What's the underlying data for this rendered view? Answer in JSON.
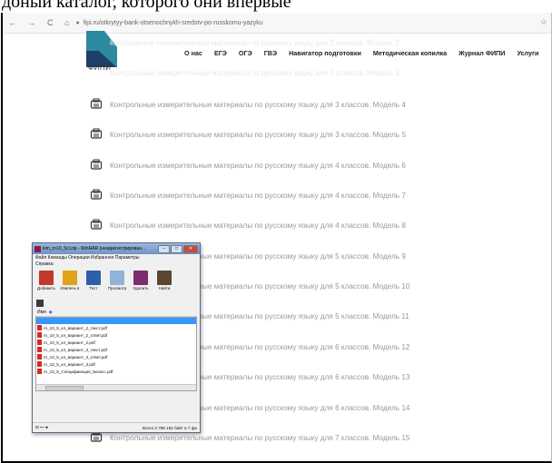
{
  "document_strip": "доный каталог, которого они впервые",
  "browser": {
    "nav_symbols": "← → C ⌂",
    "url": "fipi.ru/otkrytyy-bank-otsenochnykh-sredstv-po-russkomu-yazyku",
    "star": "☆"
  },
  "site": {
    "logo_text": "ФИПИ",
    "menu": [
      "О нас",
      "ЕГЭ",
      "ОГЭ",
      "ГВЭ",
      "Навигатор подготовки",
      "Методическая копилка",
      "Журнал ФИПИ",
      "Услуги"
    ],
    "ghost_lines": [
      "Контрольные измерительные материалы по русскому языку для 2 классов. Модель 2",
      "Контрольные измерительные материалы по русскому языку для 3 классов. Модель 3"
    ],
    "items": [
      "Контрольные измерительные материалы по русскому языку для 3 классов. Модель 4",
      "Контрольные измерительные материалы по русскому языку для 3 классов. Модель 5",
      "Контрольные измерительные материалы по русскому языку для 4 классов. Модель 6",
      "Контрольные измерительные материалы по русскому языку для 4 классов. Модель 7",
      "Контрольные измерительные материалы по русскому языку для 4 классов. Модель 8",
      "Контрольные измерительные материалы по русскому языку для 5 классов. Модель 9",
      "Контрольные измерительные материалы по русскому языку для 5 классов. Модель 10",
      "Контрольные измерительные материалы по русскому языку для 5 классов. Модель 11",
      "Контрольные измерительные материалы по русскому языку для 6 классов. Модель 12",
      "Контрольные измерительные материалы по русскому языку для 6 классов. Модель 13",
      "Контрольные измерительные материалы по русскому языку для 6 классов. Модель 14",
      "Контрольные измерительные материалы по русскому языку для 7 классов. Модель 15"
    ],
    "item_short": [
      "",
      "",
      "",
      "",
      "Контрольные изм",
      "ериалы по русскому языку для 5 классов. Модель 9",
      "ериалы по русскому языку для 5 классов. Модель 10",
      "ериалы по русскому языку для 5 классов. Модель 11",
      "ериалы по русскому языку для 6 классов. Модель 12",
      "ериалы по русскому языку для 6 классов. Модель 13",
      "ериалы по русскому языку для 6 классов. Модель 14",
      ""
    ]
  },
  "winrar": {
    "title": "kim_rn10_5cl.zip - WinRAR (незарегистрирован...",
    "controls": [
      "–",
      "□",
      "✕"
    ],
    "menu_line1": "Файл  Команды  Операции  Избранное  Параметры",
    "menu_line2": "Справка",
    "toolbar": [
      {
        "label": "Добавить",
        "color": "#c0392b"
      },
      {
        "label": "Извлечь в",
        "color": "#e1a21b"
      },
      {
        "label": "Тест",
        "color": "#2e5fa8"
      },
      {
        "label": "Просмотр",
        "color": "#8fb3d9"
      },
      {
        "label": "Удалить",
        "color": "#7b2d6e"
      },
      {
        "label": "Найти",
        "color": "#5a4632"
      }
    ],
    "column_name": "Имя",
    "files": [
      "rn_10_5_кл_вариант_2_текст.pdf",
      "rn_10_5_кл_вариант_2_ответ.pdf",
      "rn_10_5_кл_вариант_2.pdf",
      "rn_10_5_кл_вариант_3_текст.pdf",
      "rn_10_5_кл_вариант_3_ответ.pdf",
      "rn_10_5_кл_вариант_3.pdf",
      "rn_10_5_Спецификация_5класс.pdf"
    ],
    "status_left": "⊟ ⊷◄",
    "status_right": "Всего 2 798 182 байт в 7 фа"
  },
  "colors": {
    "link_gray": "#999999",
    "selection": "#3399ff",
    "logo_teal": "#2b8a9e",
    "logo_navy": "#1f3f6b"
  }
}
